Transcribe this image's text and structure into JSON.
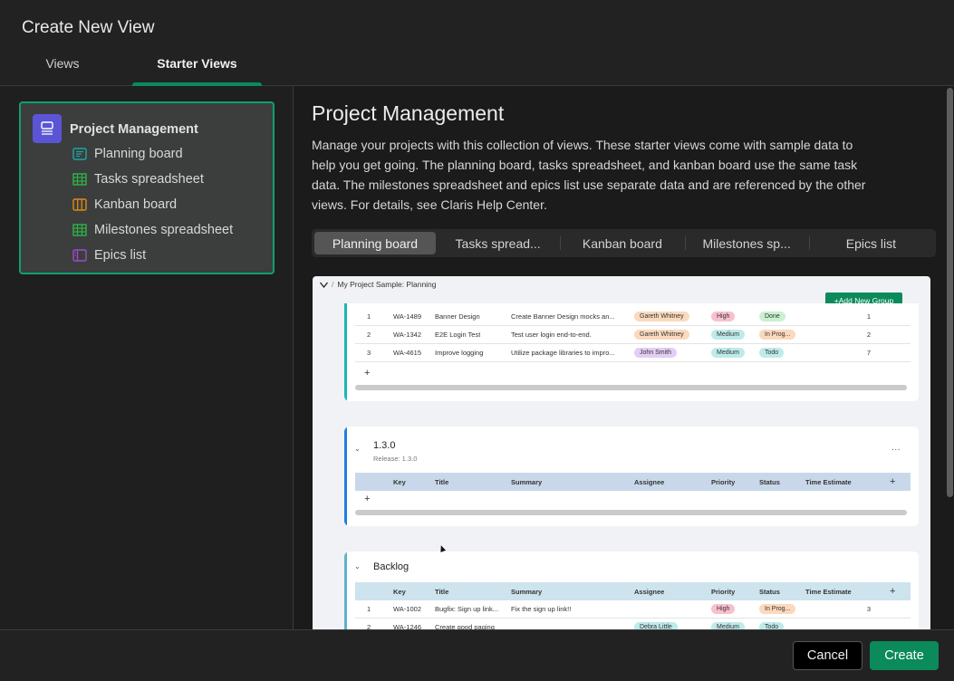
{
  "dialog": {
    "title": "Create New View",
    "tabs": [
      {
        "label": "Views",
        "active": false
      },
      {
        "label": "Starter Views",
        "active": true
      }
    ]
  },
  "sidebar": {
    "card": {
      "title": "Project Management",
      "icon": "monitor-icon",
      "items": [
        {
          "label": "Planning board",
          "icon": "board-icon",
          "color": "#1aa6a6"
        },
        {
          "label": "Tasks spreadsheet",
          "icon": "spreadsheet-icon",
          "color": "#2fb24a"
        },
        {
          "label": "Kanban board",
          "icon": "kanban-icon",
          "color": "#e08a12"
        },
        {
          "label": "Milestones spreadsheet",
          "icon": "spreadsheet-icon",
          "color": "#2fb24a"
        },
        {
          "label": "Epics list",
          "icon": "list-icon",
          "color": "#a04ac9"
        }
      ]
    }
  },
  "main": {
    "title": "Project Management",
    "description": "Manage your projects with this collection of views. These starter views come with sample data to help you get going. The planning board, tasks spreadsheet, and kanban board use the same task data. The milestones spreadsheet and epics list use separate data and are referenced by the other views. For details, see Claris Help Center.",
    "segments": [
      {
        "label": "Planning board",
        "active": true
      },
      {
        "label": "Tasks spread...",
        "active": false
      },
      {
        "label": "Kanban board",
        "active": false
      },
      {
        "label": "Milestones sp...",
        "active": false
      },
      {
        "label": "Epics list",
        "active": false
      }
    ],
    "preview": {
      "breadcrumb": "My Project Sample: Planning",
      "breadcrumb_sep": "/",
      "add_group_label": "+Add New Group",
      "columns": [
        "Key",
        "Title",
        "Summary",
        "Assignee",
        "Priority",
        "Status",
        "Time Estimate"
      ],
      "add_column": "+",
      "add_row": "+",
      "groups": [
        {
          "name": "",
          "accent": "#17b8b0",
          "rows": [
            {
              "num": "1",
              "key": "WA-1489",
              "title": "Banner Design",
              "summary": "Create Banner Design mocks an...",
              "assignee": "Gareth Whitney",
              "priority": "High",
              "status": "Done",
              "estimate": "1"
            },
            {
              "num": "2",
              "key": "WA-1342",
              "title": "E2E Login Test",
              "summary": "Test user login end-to-end.",
              "assignee": "Gareth Whitney",
              "priority": "Medium",
              "status": "In Prog...",
              "estimate": "2"
            },
            {
              "num": "3",
              "key": "WA-4615",
              "title": "Improve logging",
              "summary": "Utilize package libraries to impro...",
              "assignee": "John Smith",
              "priority": "Medium",
              "status": "Todo",
              "estimate": "7"
            }
          ]
        },
        {
          "name": "1.3.0",
          "subtitle": "Release: 1.3.0",
          "more": "...",
          "accent": "#1d7fe0",
          "rows": []
        },
        {
          "name": "Backlog",
          "accent": "#5fb1cc",
          "rows": [
            {
              "num": "1",
              "key": "WA-1002",
              "title": "Bugfix: Sign up link...",
              "summary": "Fix the sign up link!!",
              "assignee": "",
              "priority": "High",
              "status": "In Prog...",
              "estimate": "3"
            },
            {
              "num": "2",
              "key": "WA-1246",
              "title": "Create good paging",
              "summary": "",
              "assignee": "Debra Little",
              "priority": "Medium",
              "status": "Todo",
              "estimate": ""
            }
          ]
        }
      ],
      "pill_colors": {
        "Gareth Whitney": "#fbd9bd",
        "John Smith": "#e3cdf5",
        "Debra Little": "#bfeaea",
        "High": "#f8c0cf",
        "Medium": "#bfeaea",
        "Done": "#c9f0cf",
        "In Prog...": "#fbd9bd",
        "Todo": "#bfeaea"
      }
    }
  },
  "footer": {
    "cancel_label": "Cancel",
    "create_label": "Create"
  }
}
